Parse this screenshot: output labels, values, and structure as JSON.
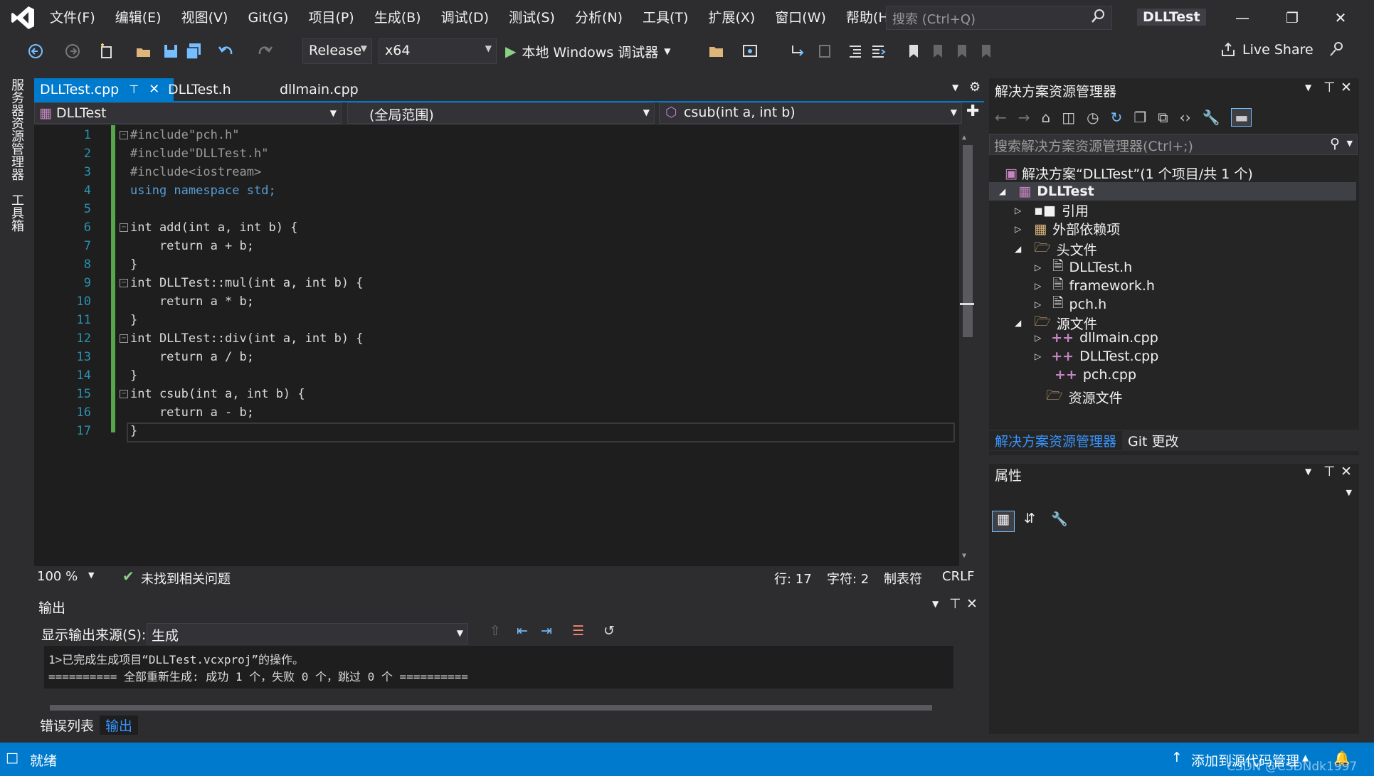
{
  "menu": [
    "文件(F)",
    "编辑(E)",
    "视图(V)",
    "Git(G)",
    "项目(P)",
    "生成(B)",
    "调试(D)",
    "测试(S)",
    "分析(N)",
    "工具(T)",
    "扩展(X)",
    "窗口(W)",
    "帮助(H)"
  ],
  "search": {
    "placeholder": "搜索 (Ctrl+Q)"
  },
  "solution_title": "DLLTest",
  "toolbar": {
    "config": "Release",
    "platform": "x64",
    "run_label": "本地 Windows 调试器",
    "live_share": "Live Share"
  },
  "leftstrip": {
    "server_explorer": "服务器资源管理器",
    "toolbox": "工具箱"
  },
  "tabs": [
    {
      "label": "DLLTest.cpp"
    },
    {
      "label": "DLLTest.h"
    },
    {
      "label": "dllmain.cpp"
    }
  ],
  "navbar": {
    "project": "DLLTest",
    "scope": "(全局范围)",
    "member": "csub(int a, int b)"
  },
  "code": [
    {
      "n": "1",
      "text": "#include\"pch.h\""
    },
    {
      "n": "2",
      "text": "#include\"DLLTest.h\""
    },
    {
      "n": "3",
      "text": "#include<iostream>"
    },
    {
      "n": "4",
      "text": "using namespace std;"
    },
    {
      "n": "5",
      "text": ""
    },
    {
      "n": "6",
      "text": "int add(int a, int b) {"
    },
    {
      "n": "7",
      "text": "    return a + b;"
    },
    {
      "n": "8",
      "text": "}"
    },
    {
      "n": "9",
      "text": "int DLLTest::mul(int a, int b) {"
    },
    {
      "n": "10",
      "text": "    return a * b;"
    },
    {
      "n": "11",
      "text": "}"
    },
    {
      "n": "12",
      "text": "int DLLTest::div(int a, int b) {"
    },
    {
      "n": "13",
      "text": "    return a / b;"
    },
    {
      "n": "14",
      "text": "}"
    },
    {
      "n": "15",
      "text": "int csub(int a, int b) {"
    },
    {
      "n": "16",
      "text": "    return a - b;"
    },
    {
      "n": "17",
      "text": "}"
    }
  ],
  "editor_status": {
    "zoom": "100 %",
    "issues": "未找到相关问题",
    "line": "行: 17",
    "col": "字符: 2",
    "tabs": "制表符",
    "eol": "CRLF"
  },
  "output": {
    "title": "输出",
    "source_label": "显示输出来源(S):",
    "source_value": "生成",
    "lines": [
      "1>已完成生成项目“DLLTest.vcxproj”的操作。",
      "========== 全部重新生成: 成功 1 个，失败 0 个，跳过 0 个 =========="
    ]
  },
  "bottom_tabs": [
    "错误列表",
    "输出"
  ],
  "status": {
    "ready": "就绪",
    "source_control": "添加到源代码管理",
    "watermark": "CSDN @CSDNdk1997"
  },
  "solution_explorer": {
    "title": "解决方案资源管理器",
    "search_placeholder": "搜索解决方案资源管理器(Ctrl+;)",
    "solution": "解决方案“DLLTest”(1 个项目/共 1 个)",
    "project": "DLLTest",
    "nodes": [
      "引用",
      "外部依赖项",
      "头文件",
      "DLLTest.h",
      "framework.h",
      "pch.h",
      "源文件",
      "dllmain.cpp",
      "DLLTest.cpp",
      "pch.cpp",
      "资源文件"
    ],
    "tabs": [
      "解决方案资源管理器",
      "Git 更改"
    ]
  },
  "properties": {
    "title": "属性"
  }
}
